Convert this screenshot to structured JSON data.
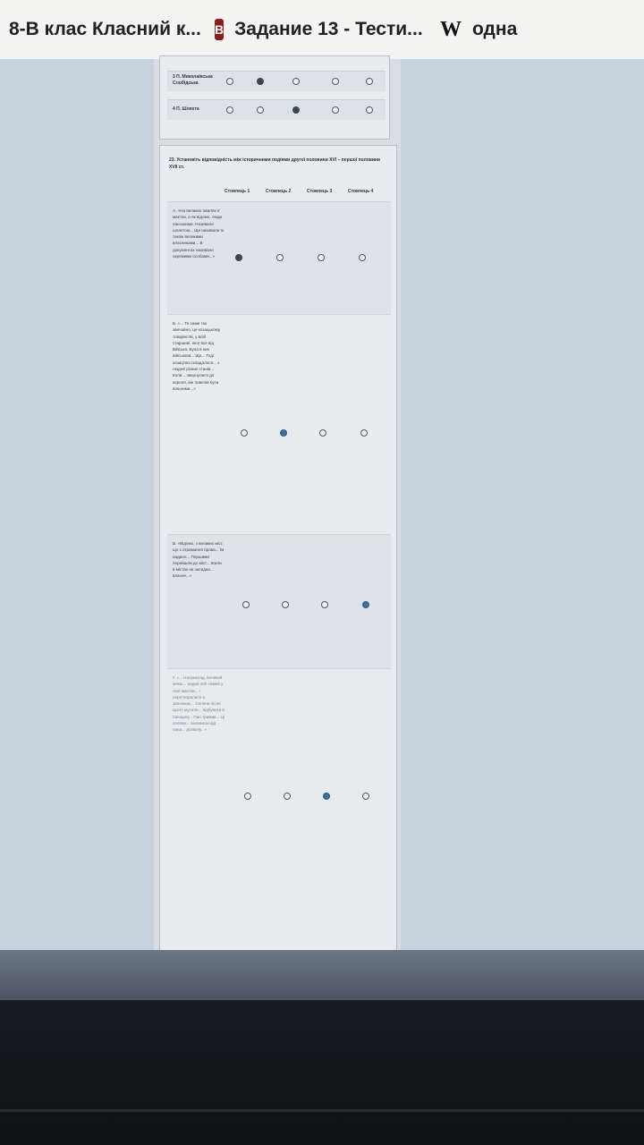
{
  "browser": {
    "tabs": [
      {
        "icon": "diary-icon",
        "title": "8-В клас Класний к..."
      },
      {
        "icon": "v-icon",
        "icon_text": "В",
        "title": "Задание 13 - Тести..."
      },
      {
        "icon": "wikipedia-icon",
        "icon_text": "W",
        "title": "одна"
      }
    ]
  },
  "previous_question": {
    "rows": [
      {
        "label": "3 П. Миколаївська Слобідська",
        "selected": 1
      },
      {
        "label": "4 П. Шляхта",
        "selected": 2
      }
    ]
  },
  "question": {
    "title": "23. Установіть відповідність між історичними подіями другої половини XVI – першої половини XVII ст.",
    "columns": [
      "Стовпець 1",
      "Стовпець 2",
      "Стовпець 3",
      "Стовпець 4"
    ],
    "rows": [
      {
        "text": "А. «На великих землях її маєтки, а як відомо, люди панськими. Називали шляхтою... Ще називали їх також великими власниками... В документах називали окремими особами...»",
        "selected": 0
      },
      {
        "text": "Б. «... Те саме так звичайно, це козацькому товаристві, у всій старшині, якої все від Війська. Була в них військова... Ще... Тоді козацтво складалося... з людей різних станів... Коли... звернулися до короля, він повелів бути вільними...»",
        "selected": 1
      },
      {
        "text": "В. «Відомо, з великих міст, що з отримання права... Їм надано... Першими перейшли до міст... Жили в містах на засадах... власне...»",
        "selected": 3
      },
      {
        "text": "Г. «... Наприклад, великий князь... надав 300 семей у свої маєтки... і перетворилися в залежних... Селяни після цього мусили... відбувати в панщину... Пан тримав... Ці селяни... залежали від пана... дозволу...»",
        "selected": 2
      }
    ]
  },
  "colors": {
    "checked": "#3a4654",
    "checked_blue": "#3f6f9c",
    "page_bg": "#c6d2dc"
  }
}
